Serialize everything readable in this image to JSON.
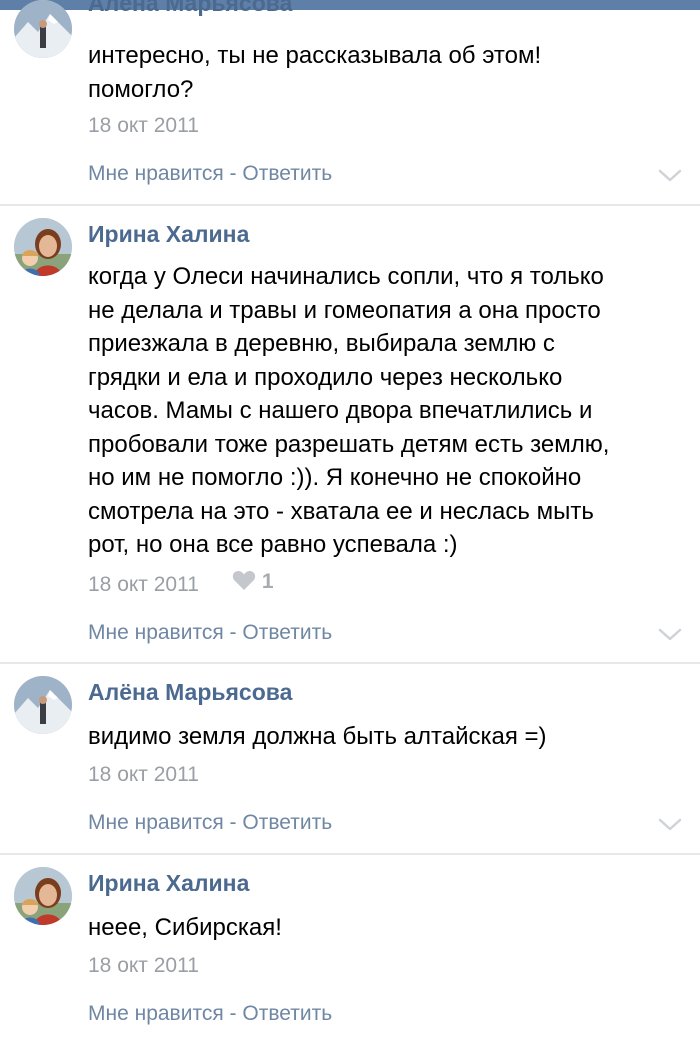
{
  "comments": [
    {
      "author": "Алёна Марьясова",
      "lines": [
        "интересно, ты не рассказывала об этом!",
        "помогло?"
      ],
      "date": "18 окт 2011",
      "like_label": "Мне нравится",
      "separator": " - ",
      "reply_label": "Ответить",
      "avatar_icon": "mountain-photo-avatar-icon"
    },
    {
      "author": "Ирина Халина",
      "lines": [
        "когда у Олеси начинались сопли, что я только",
        "не делала и травы и гомеопатия а она просто",
        "приезжала в деревню, выбирала землю с",
        "грядки и ела и проходило через несколько",
        "часов. Мамы с нашего двора впечатлились и",
        "пробовали тоже разрешать детям есть землю,",
        "но им не помогло :)). Я конечно не спокойно",
        "смотрела на это - хватала ее и неслась мыть",
        "рот, но она все равно успевала :)"
      ],
      "date": "18 окт 2011",
      "likes_count": "1",
      "like_label": "Мне нравится",
      "separator": " - ",
      "reply_label": "Ответить",
      "avatar_icon": "woman-child-photo-avatar-icon"
    },
    {
      "author": "Алёна Марьясова",
      "lines": [
        "видимо земля должна быть алтайская =)"
      ],
      "date": "18 окт 2011",
      "like_label": "Мне нравится",
      "separator": " - ",
      "reply_label": "Ответить",
      "avatar_icon": "mountain-photo-avatar-icon"
    },
    {
      "author": "Ирина Халина",
      "lines": [
        "неее, Сибирская!"
      ],
      "date": "18 окт 2011",
      "like_label": "Мне нравится",
      "separator": " - ",
      "reply_label": "Ответить",
      "avatar_icon": "woman-child-photo-avatar-icon"
    }
  ],
  "colors": {
    "author": "#4c6a90",
    "link": "#6f87a3",
    "meta": "#9a9fa6",
    "divider": "#e6e8eb"
  }
}
